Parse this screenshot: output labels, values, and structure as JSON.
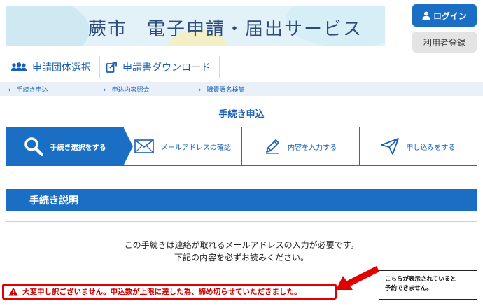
{
  "header": {
    "title": "蕨市　電子申請・届出サービス",
    "login_label": "ログイン",
    "register_label": "利用者登録"
  },
  "menu": {
    "items": [
      {
        "label": "申請団体選択",
        "icon": "group-icon"
      },
      {
        "label": "申請書ダウンロード",
        "icon": "download-form-icon"
      }
    ]
  },
  "breadcrumb": {
    "items": [
      "手続き申込",
      "申込内容照会",
      "職責署名検証"
    ]
  },
  "page_title": "手続き申込",
  "steps": [
    {
      "label": "手続き選択をする",
      "icon": "search-icon",
      "active": true
    },
    {
      "label": "メールアドレスの確認",
      "icon": "envelope-icon",
      "active": false
    },
    {
      "label": "内容を入力する",
      "icon": "pencil-icon",
      "active": false
    },
    {
      "label": "申し込みをする",
      "icon": "send-icon",
      "active": false
    }
  ],
  "section": {
    "title": "手続き説明",
    "line1": "この手続きは連絡が取れるメールアドレスの入力が必要です。",
    "line2": "下記の内容を必ずお読みください。"
  },
  "warning": {
    "text": "大変申し訳ございません。申込数が上限に達した為、締め切らせていただきました。"
  },
  "annotation": {
    "line1": "こちらが表示されていると",
    "line2": "予約できません。"
  },
  "colors": {
    "primary": "#1a6fc4",
    "warning": "#e00000",
    "breadcrumb_bg": "#e9f0f8"
  }
}
